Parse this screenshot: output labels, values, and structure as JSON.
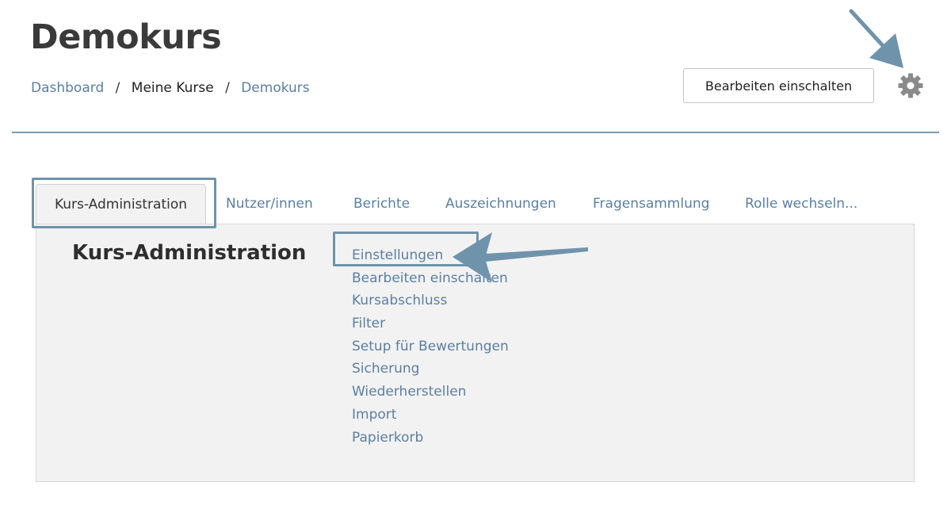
{
  "header": {
    "title": "Demokurs",
    "breadcrumb": [
      {
        "label": "Dashboard"
      },
      {
        "label": "Meine Kurse"
      },
      {
        "label": "Demokurs"
      }
    ],
    "edit_button_label": "Bearbeiten einschalten",
    "settings_icon": "gear-icon"
  },
  "tabs": [
    {
      "label": "Kurs-Administration",
      "active": true
    },
    {
      "label": "Nutzer/innen"
    },
    {
      "label": "Berichte"
    },
    {
      "label": "Auszeichnungen"
    },
    {
      "label": "Fragensammlung"
    },
    {
      "label": "Rolle wechseln..."
    }
  ],
  "panel": {
    "heading": "Kurs-Administration",
    "links": [
      "Einstellungen",
      "Bearbeiten einschalten",
      "Kursabschluss",
      "Filter",
      "Setup für Bewertungen",
      "Sicherung",
      "Wiederherstellen",
      "Import",
      "Papierkorb"
    ]
  },
  "colors": {
    "link": "#5b7fa1",
    "annotation": "#6f93ab",
    "panel_bg": "#f2f2f2",
    "header_rule": "#7d9aae"
  }
}
